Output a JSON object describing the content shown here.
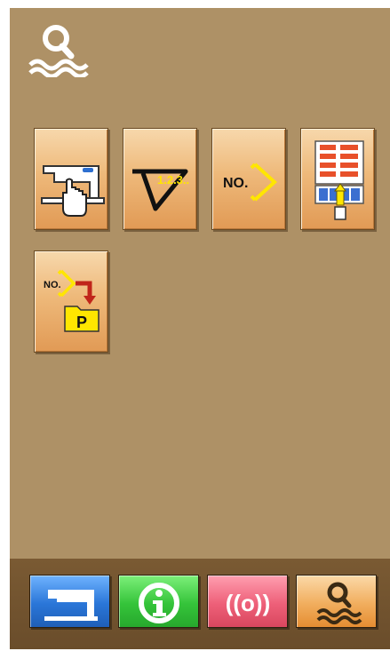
{
  "header": {
    "icon": "search-icon"
  },
  "tiles": [
    {
      "icon": "sewing-machine-touch-icon"
    },
    {
      "icon": "sequence-triangle-icon",
      "label": "1.2.3.."
    },
    {
      "icon": "number-select-icon",
      "label": "NO."
    },
    {
      "icon": "pattern-layout-icon"
    },
    {
      "icon": "number-to-p-folder-icon",
      "label": "NO.",
      "sub_label": "P"
    }
  ],
  "bottom_bar": [
    {
      "icon": "sewing-machine-icon",
      "color": "#2a76d8"
    },
    {
      "icon": "info-icon",
      "color": "#35c43a"
    },
    {
      "icon": "communication-icon",
      "label": "((o))",
      "color": "#ee6079"
    },
    {
      "icon": "search-icon",
      "color": "#f1ae5e"
    }
  ],
  "colors": {
    "background": "#ae9166",
    "tile": "#eeb97a",
    "bar": "#6a4d2b"
  }
}
